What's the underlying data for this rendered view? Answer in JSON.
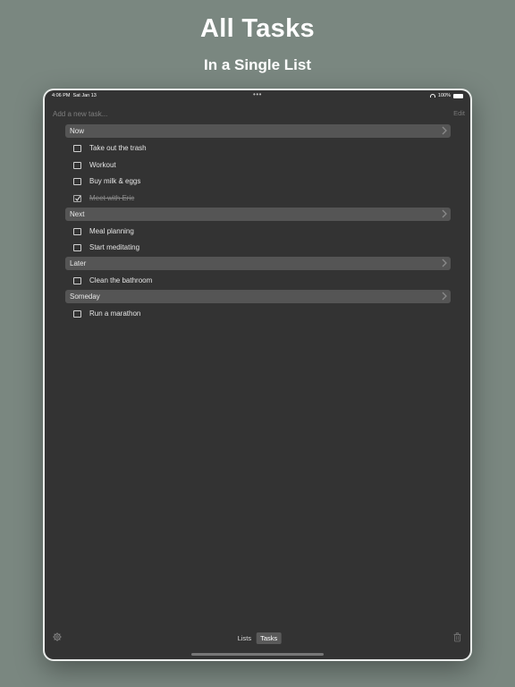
{
  "headline": {
    "title": "All Tasks",
    "subtitle": "In a Single List"
  },
  "status_bar": {
    "time": "4:06 PM",
    "date": "Sat Jan 13",
    "dots": "•••",
    "battery": "100%"
  },
  "add_task": {
    "placeholder": "Add a new task...",
    "edit_label": "Edit"
  },
  "sections": [
    {
      "label": "Now",
      "tasks": [
        {
          "text": "Take out the trash",
          "done": false
        },
        {
          "text": "Workout",
          "done": false
        },
        {
          "text": "Buy milk & eggs",
          "done": false
        },
        {
          "text": "Meet with Eric",
          "done": true
        }
      ]
    },
    {
      "label": "Next",
      "tasks": [
        {
          "text": "Meal planning",
          "done": false
        },
        {
          "text": "Start meditating",
          "done": false
        }
      ]
    },
    {
      "label": "Later",
      "tasks": [
        {
          "text": "Clean the bathroom",
          "done": false
        }
      ]
    },
    {
      "label": "Someday",
      "tasks": [
        {
          "text": "Run a marathon",
          "done": false
        }
      ]
    }
  ],
  "bottom_bar": {
    "tabs": [
      "Lists",
      "Tasks"
    ],
    "active_tab": "Tasks"
  },
  "icons": {
    "settings": "gear-icon",
    "delete": "trash-icon",
    "disclosure": "chevron-right-icon",
    "check": "checkmark-icon"
  },
  "colors": {
    "background": "#7a8780",
    "screen": "#333333",
    "section_header": "#555555"
  }
}
